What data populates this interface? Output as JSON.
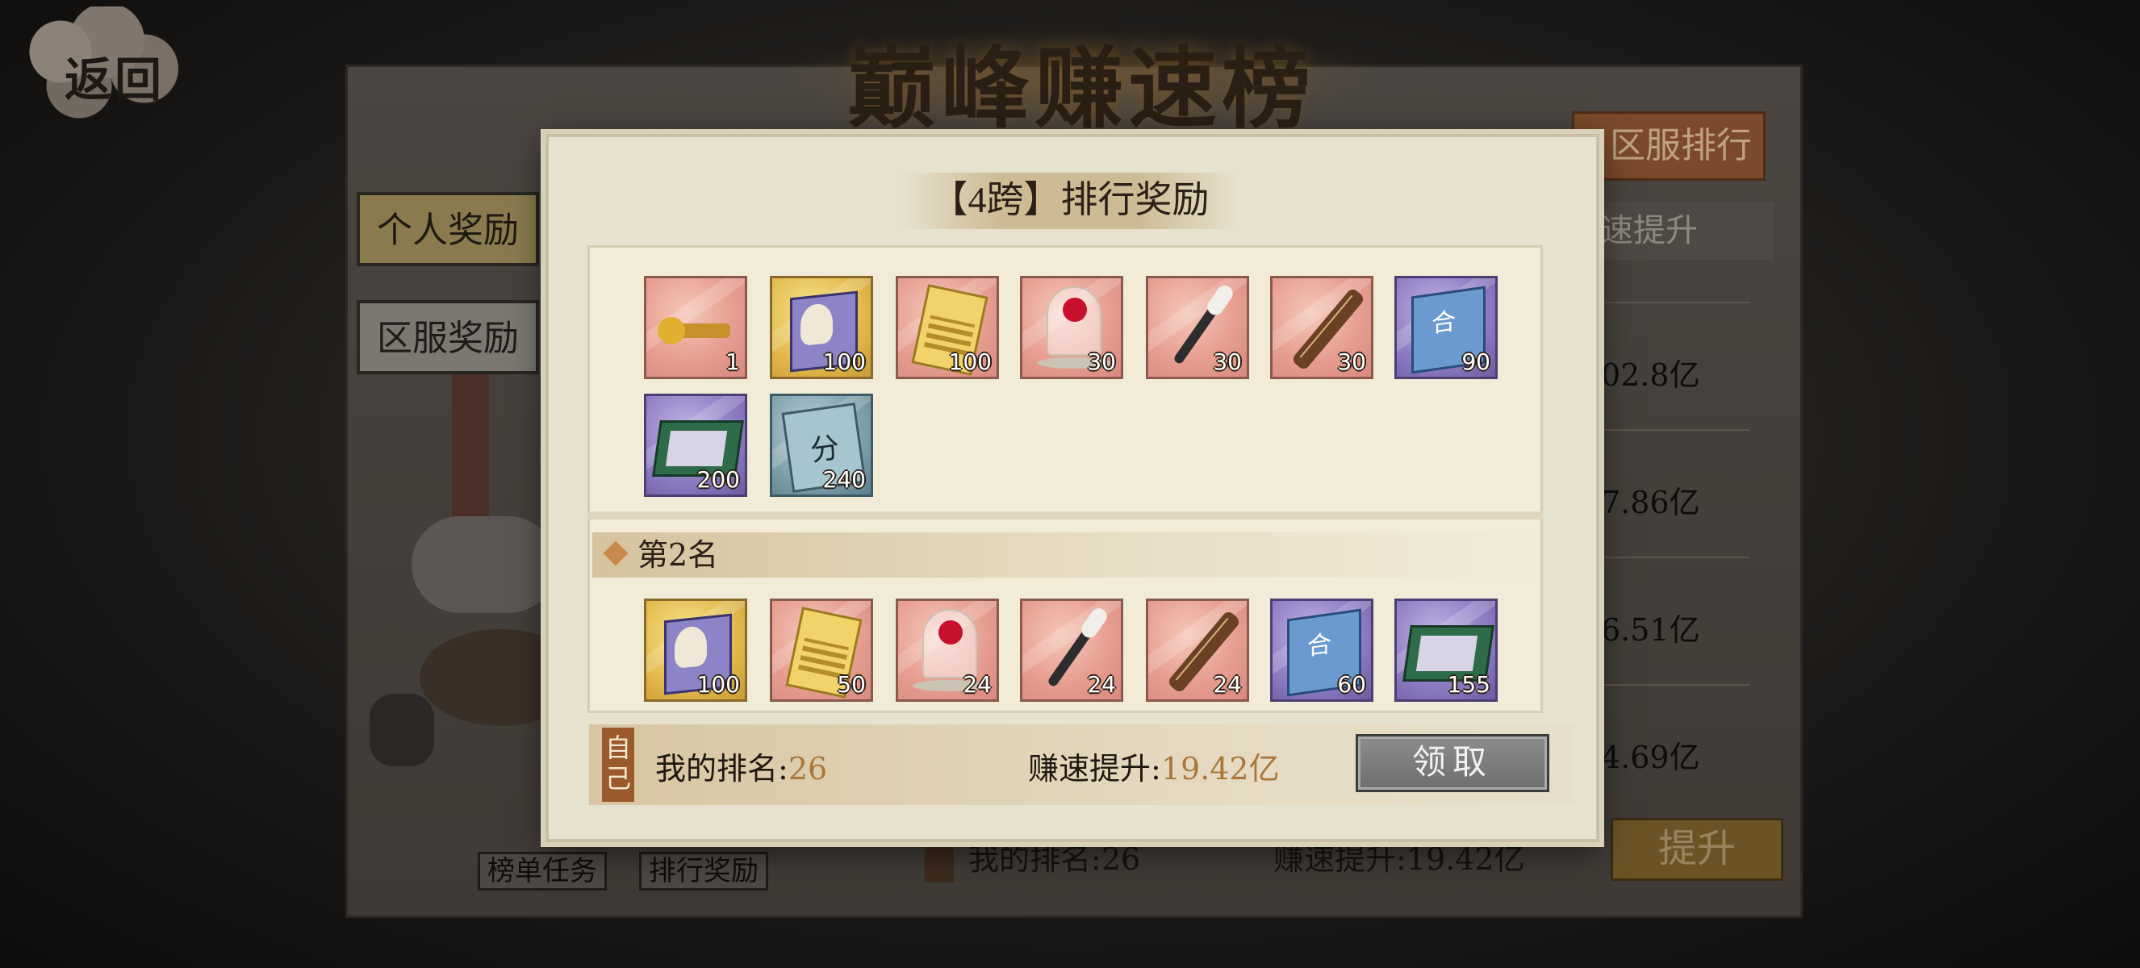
{
  "nav": {
    "back_label": "返回"
  },
  "board": {
    "title": "巅峰赚速榜",
    "server_rank_button": "区服排行",
    "tabs": [
      {
        "label": "个人奖励",
        "active": true
      },
      {
        "label": "区服奖励",
        "active": false
      }
    ],
    "speed_header": "速提升",
    "rank_values": [
      "02.8亿",
      "7.86亿",
      "6.51亿",
      "4.69亿"
    ],
    "bottom_buttons": {
      "tasks": "榜单任务",
      "rank_rewards": "排行奖励"
    },
    "my_rank": {
      "label": "我的排名:",
      "value": "26"
    },
    "speed_up": {
      "label": "赚速提升:",
      "value": "19.42亿"
    },
    "upgrade_button": "提升"
  },
  "modal": {
    "title": "【4跨】排行奖励",
    "sections": [
      {
        "header": "",
        "items": [
          {
            "icon": "golden-token-icon",
            "style": "red",
            "qty": "1"
          },
          {
            "icon": "character-book-icon",
            "style": "gold",
            "qty": "100"
          },
          {
            "icon": "gold-card-icon",
            "style": "red",
            "qty": "100"
          },
          {
            "icon": "rose-dome-icon",
            "style": "red",
            "qty": "30"
          },
          {
            "icon": "calligraphy-brush-icon",
            "style": "red",
            "qty": "30"
          },
          {
            "icon": "guqin-icon",
            "style": "red",
            "qty": "30"
          },
          {
            "icon": "skill-manual-icon",
            "style": "purple",
            "qty": "90"
          },
          {
            "icon": "gift-box-icon",
            "style": "purple",
            "qty": "200"
          },
          {
            "icon": "score-card-icon",
            "style": "blue",
            "qty": "240"
          }
        ]
      },
      {
        "header": "第2名",
        "items": [
          {
            "icon": "character-book-icon",
            "style": "gold",
            "qty": "100"
          },
          {
            "icon": "gold-card-icon",
            "style": "red",
            "qty": "50"
          },
          {
            "icon": "rose-dome-icon",
            "style": "red",
            "qty": "24"
          },
          {
            "icon": "calligraphy-brush-icon",
            "style": "red",
            "qty": "24"
          },
          {
            "icon": "guqin-icon",
            "style": "red",
            "qty": "24"
          },
          {
            "icon": "skill-manual-icon",
            "style": "purple",
            "qty": "60"
          },
          {
            "icon": "gift-box-icon",
            "style": "purple",
            "qty": "155"
          }
        ]
      }
    ],
    "self_bar": {
      "tag": "自己",
      "my_rank_label": "我的排名:",
      "my_rank_value": "26",
      "speed_label": "赚速提升:",
      "speed_value": "19.42亿",
      "claim_button": "领取"
    }
  }
}
